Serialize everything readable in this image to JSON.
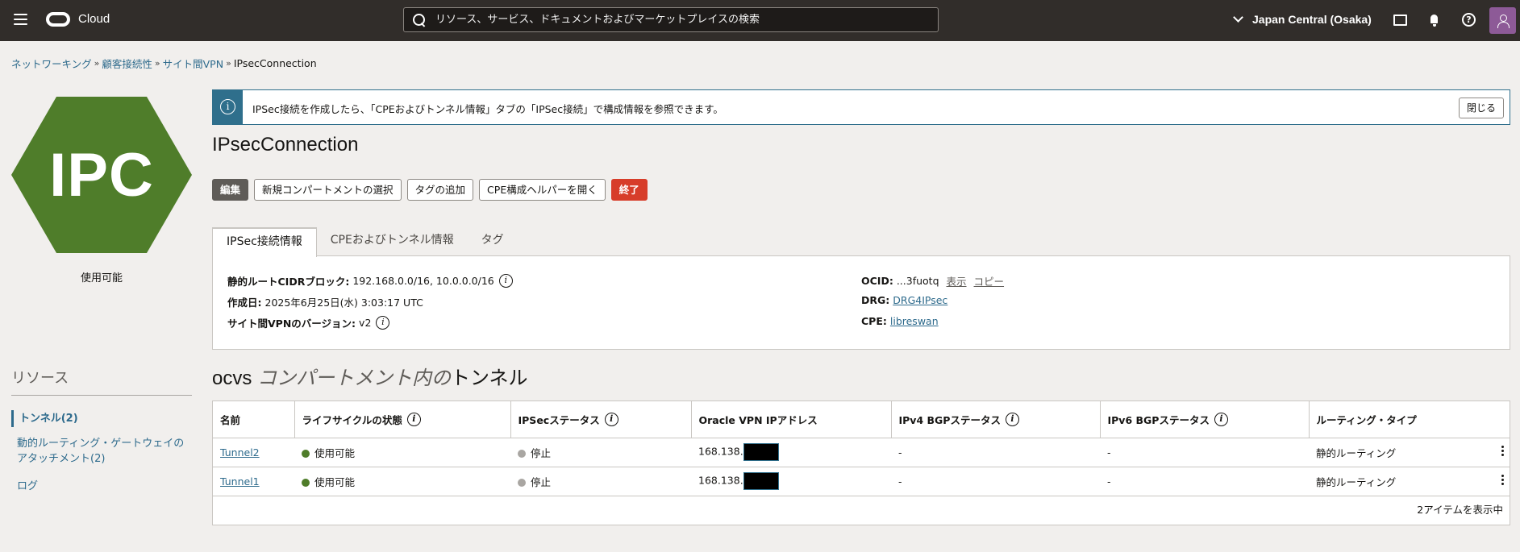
{
  "header": {
    "brand": "Cloud",
    "search_placeholder": "リソース、サービス、ドキュメントおよびマーケットプレイスの検索",
    "region": "Japan Central (Osaka)"
  },
  "breadcrumb": {
    "items": [
      "ネットワーキング",
      "顧客接続性",
      "サイト間VPN"
    ],
    "current": "IPsecConnection",
    "separator": "»"
  },
  "resource_icon": {
    "text": "IPC",
    "color": "#4f7d2a",
    "status": "使用可能"
  },
  "resources": {
    "title": "リソース",
    "items": [
      "トンネル(2)",
      "動的ルーティング・ゲートウェイのアタッチメント(2)",
      "ログ"
    ]
  },
  "banner": {
    "text": "IPSec接続を作成したら、「CPEおよびトンネル情報」タブの「IPSec接続」で構成情報を参照できます。",
    "close_label": "閉じる"
  },
  "title": "IPsecConnection",
  "actions": {
    "edit": "編集",
    "move": "新規コンパートメントの選択",
    "add_tags": "タグの追加",
    "cpe_helper": "CPE構成ヘルパーを開く",
    "terminate": "終了"
  },
  "tabs": [
    "IPSec接続情報",
    "CPEおよびトンネル情報",
    "タグ"
  ],
  "details": {
    "static_routes_label": "静的ルートCIDRブロック:",
    "static_routes_value": "192.168.0.0/16, 10.0.0.0/16",
    "created_label": "作成日:",
    "created_value": "2025年6月25日(水) 3:03:17 UTC",
    "vpn_version_label": "サイト間VPNのバージョン:",
    "vpn_version_value": "v2",
    "ocid_label": "OCID:",
    "ocid_value": "...3fuotq",
    "ocid_show": "表示",
    "ocid_copy": "コピー",
    "drg_label": "DRG:",
    "drg_value": "DRG4IPsec",
    "cpe_label": "CPE:",
    "cpe_value": "libreswan"
  },
  "tunnels_section": {
    "compartment": "ocvs",
    "title_italic": "コンパートメント内の",
    "title_tail": "トンネル"
  },
  "table": {
    "columns": [
      "名前",
      "ライフサイクルの状態",
      "IPSecステータス",
      "Oracle VPN IPアドレス",
      "IPv4 BGPステータス",
      "IPv6 BGPステータス",
      "ルーティング・タイプ"
    ],
    "rows": [
      {
        "name": "Tunnel2",
        "lifecycle": "使用可能",
        "ipsec": "停止",
        "ip_prefix": "168.138.",
        "ipv4_bgp": "-",
        "ipv6_bgp": "-",
        "routing": "静的ルーティング"
      },
      {
        "name": "Tunnel1",
        "lifecycle": "使用可能",
        "ipsec": "停止",
        "ip_prefix": "168.138.",
        "ipv4_bgp": "-",
        "ipv6_bgp": "-",
        "routing": "静的ルーティング"
      }
    ],
    "footer": "2アイテムを表示中"
  }
}
